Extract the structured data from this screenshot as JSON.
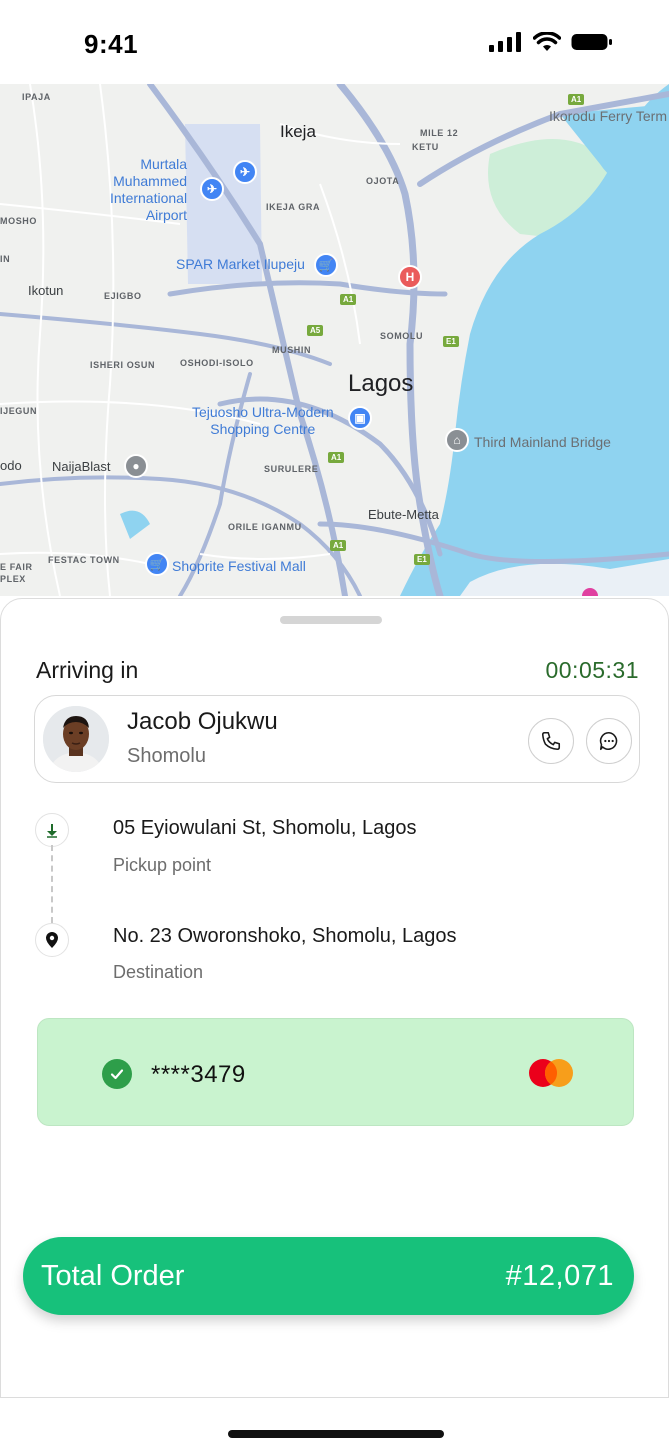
{
  "status_bar": {
    "time": "9:41"
  },
  "map": {
    "labels": {
      "ipaja": "IPAJA",
      "ikeja": "Ikeja",
      "mile12": "MILE 12",
      "ketu": "KETU",
      "ikorodu_ferry": "Ikorodu Ferry Term",
      "murtala_airport": "Murtala\nMuhammed\nInternational\nAirport",
      "ojota": "OJOTA",
      "mosho": "MOSHO",
      "ikeja_gra": "IKEJA GRA",
      "spar_market": "SPAR Market Ilupeju",
      "ikotun": "Ikotun",
      "ejigbo": "EJIGBO",
      "somolu": "SOMOLU",
      "mushin": "MUSHIN",
      "isheri_osun": "ISHERI OSUN",
      "oshodi_isolo": "OSHODI-ISOLO",
      "lagos": "Lagos",
      "ijegun": "IJEGUN",
      "tejuosho": "Tejuosho Ultra-Modern\nShopping Centre",
      "third_mainland": "Third Mainland Bridge",
      "odo": "odo",
      "naijablast": "NaijaBlast",
      "surulere": "SURULERE",
      "ebute_metta": "Ebute-Metta",
      "orile_iganmu": "ORILE IGANMU",
      "festac_town": "FESTAC TOWN",
      "fair": "E FAIR",
      "plex": "PLEX",
      "shoprite": "Shoprite Festival Mall",
      "in": "IN"
    },
    "shields": {
      "a1": "A1",
      "a5": "A5",
      "e1": "E1"
    },
    "hospital_letter": "H"
  },
  "sheet": {
    "arriving_label": "Arriving in",
    "arriving_timer": "00:05:31",
    "driver": {
      "name": "Jacob Ojukwu",
      "area": "Shomolu"
    },
    "route": {
      "pickup_address": "05 Eyiowulani St, Shomolu, Lagos",
      "pickup_label": "Pickup point",
      "destination_address": "No. 23 Oworonshoko, Shomolu, Lagos",
      "destination_label": "Destination"
    },
    "payment": {
      "card_number": "****3479",
      "card_brand_icon": "mastercard-icon"
    },
    "total": {
      "label": "Total Order",
      "value": "#12,071"
    }
  },
  "colors": {
    "accent_green": "#17c17b",
    "timer_green": "#2a6b2c",
    "payment_bg": "#c9f3cf",
    "map_water": "#8fd3f0",
    "map_road": "#a9b7d8"
  }
}
